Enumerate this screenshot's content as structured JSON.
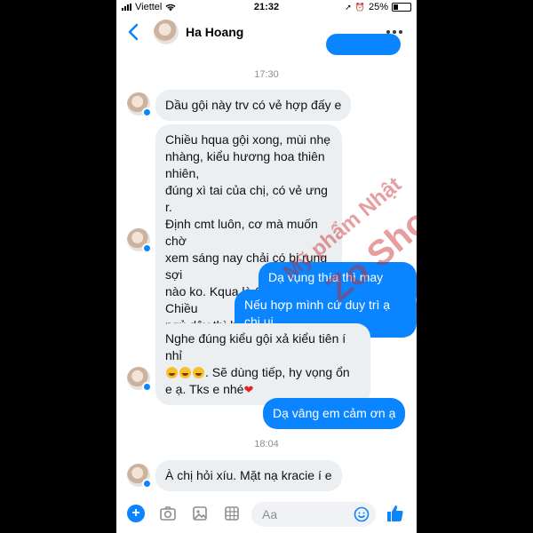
{
  "status_bar": {
    "carrier": "Viettel",
    "time": "21:32",
    "battery": "25%",
    "battery_level": 0.25
  },
  "header": {
    "contact_name": "Ha Hoang"
  },
  "thread": {
    "timestamp1": "17:30",
    "m1": "Dầu gội này trv có vẻ hợp đấy e",
    "m2": [
      "Chiều hqua gội xong, mùi nhẹ",
      "nhàng, kiểu hương hoa thiên nhiên,",
      "đúng xì tai của chị, có vẻ ưng r.",
      "Định cmt luôn, cơ mà muốn chờ",
      "xem sáng nay chải có bị rụng sợi",
      "nào ko. Kqua là 0 sợi nhé. Chiều",
      "ngủ dậy thì bị rụng 2 sợi thôi"
    ],
    "m3": "Dạ vụng thía thì may quá ạ",
    "m4": "Nếu hợp mình cứ duy trì ạ chị ui",
    "m5": [
      "Nghe đúng kiểu gội xả kiểu tiên í nhỉ",
      ". Sẽ dùng tiếp, hy vọng ổn",
      "e ạ. Tks e nhé"
    ],
    "m6": "Dạ vâng em cảm ơn ạ",
    "timestamp2": "18:04",
    "m7": "À chị hỏi xíu. Mặt nạ kracie í e"
  },
  "watermark": {
    "line1": "Mỹ phẩm Nhật",
    "line2": "Zo Shop"
  },
  "composer": {
    "placeholder": "Aa"
  },
  "colors": {
    "accent": "#0a84ff",
    "incoming_bubble": "#eceff1"
  }
}
